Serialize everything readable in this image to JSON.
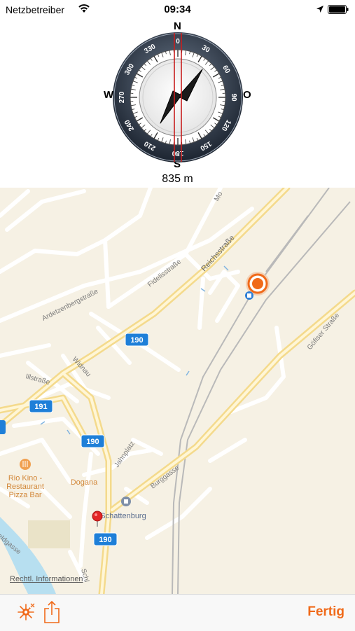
{
  "status_bar": {
    "carrier": "Netzbetreiber",
    "time": "09:34"
  },
  "compass": {
    "north": "N",
    "south": "S",
    "west": "W",
    "east": "O",
    "distance": "835 m",
    "ring_labels": [
      "0",
      "30",
      "60",
      "90",
      "120",
      "150",
      "180",
      "210",
      "240",
      "270",
      "300",
      "330"
    ]
  },
  "map": {
    "streets": {
      "reichsstrasse": "Reichsstraße",
      "fidelisstrasse": "Fidelisstraße",
      "ardetzenbergstrasse": "Ardetzenbergstraße",
      "widnau": "Widnau",
      "illstrasse": "Illstraße",
      "jahnplatz": "Jahnplatz",
      "burggasse": "Burggasse",
      "goefiser_strasse": "Göfiser Straße",
      "mo_partial": "Mo",
      "schloss_partial": "Schl",
      "gasse_partial": "eldgasse"
    },
    "route_badges": [
      "190",
      "191",
      "190",
      "190"
    ],
    "pois": {
      "rio_kino_line1": "Rio Kino -",
      "rio_kino_line2": "Restaurant",
      "rio_kino_line3": "Pizza Bar",
      "dogana": "Dogana",
      "schattenburg": "Schattenburg"
    },
    "legal": "Rechtl. Informationen"
  },
  "toolbar": {
    "done": "Fertig"
  },
  "colors": {
    "accent": "#f06a1a",
    "route_badge": "#1e7fd8",
    "map_bg": "#f6f1e4"
  }
}
